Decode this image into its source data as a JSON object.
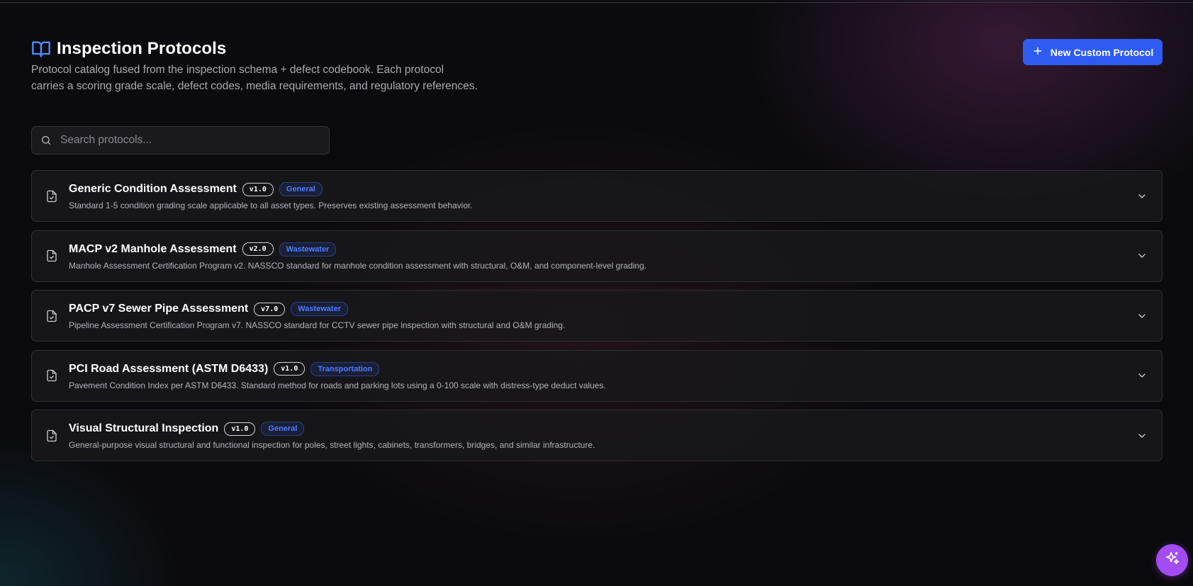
{
  "header": {
    "title": "Inspection Protocols",
    "subtitle": "Protocol catalog fused from the inspection schema + defect codebook. Each protocol carries a scoring grade scale, defect codes, media requirements, and regulatory references.",
    "title_icon": "book-open-icon"
  },
  "actions": {
    "new_protocol_label": "New Custom Protocol",
    "new_protocol_icon": "plus-icon"
  },
  "search": {
    "placeholder": "Search protocols...",
    "value": "",
    "icon": "search-icon"
  },
  "protocols": [
    {
      "title": "Generic Condition Assessment",
      "version": "v1.0",
      "category": "General",
      "description": "Standard 1-5 condition grading scale applicable to all asset types. Preserves existing assessment behavior."
    },
    {
      "title": "MACP v2 Manhole Assessment",
      "version": "v2.0",
      "category": "Wastewater",
      "description": "Manhole Assessment Certification Program v2. NASSCO standard for manhole condition assessment with structural, O&M, and component-level grading."
    },
    {
      "title": "PACP v7 Sewer Pipe Assessment",
      "version": "v7.0",
      "category": "Wastewater",
      "description": "Pipeline Assessment Certification Program v7. NASSCO standard for CCTV sewer pipe inspection with structural and O&M grading."
    },
    {
      "title": "PCI Road Assessment (ASTM D6433)",
      "version": "v1.0",
      "category": "Transportation",
      "description": "Pavement Condition Index per ASTM D6433. Standard method for roads and parking lots using a 0-100 scale with distress-type deduct values."
    },
    {
      "title": "Visual Structural Inspection",
      "version": "v1.0",
      "category": "General",
      "description": "General-purpose visual structural and functional inspection for poles, street lights, cabinets, transformers, bridges, and similar infrastructure."
    }
  ],
  "colors": {
    "accent": "#2f5cf0",
    "badge_text": "#4f7dff",
    "fab": "#a24cf2",
    "background": "#0b0b0f"
  }
}
